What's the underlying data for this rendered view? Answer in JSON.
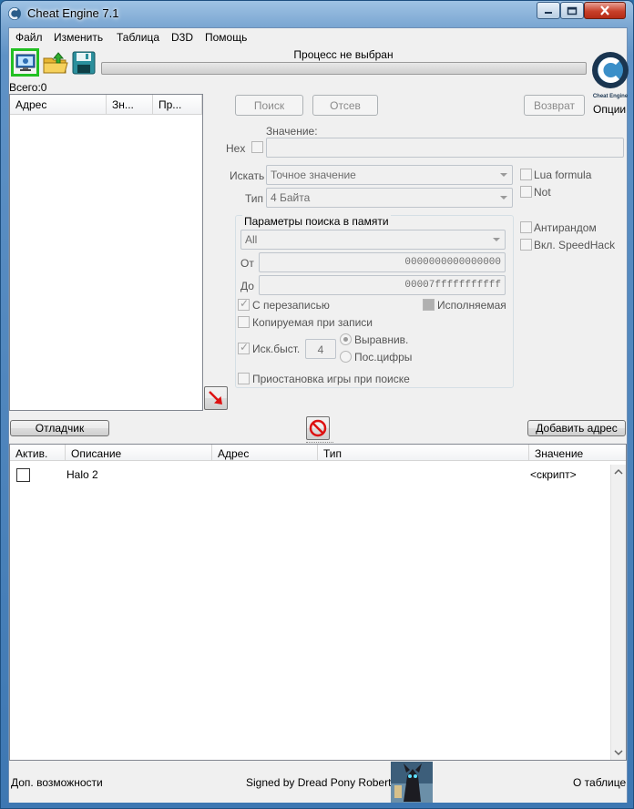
{
  "window": {
    "title": "Cheat Engine 7.1"
  },
  "menu": [
    "Файл",
    "Изменить",
    "Таблица",
    "D3D",
    "Помощь"
  ],
  "toolbar": {
    "process_label": "Процесс не выбран",
    "options_label": "Опции",
    "logo_text": "Cheat Engine"
  },
  "found": {
    "total_label": "Всего:0",
    "columns": [
      "Адрес",
      "Зн...",
      "Пр..."
    ]
  },
  "scan": {
    "first_scan": "Поиск",
    "next_scan": "Отсев",
    "undo_scan": "Возврат",
    "value_label": "Значение:",
    "hex_label": "Hex",
    "scan_type_label": "Искать",
    "scan_type_value": "Точное значение",
    "value_type_label": "Тип",
    "value_type_value": "4 Байта",
    "lua_formula": "Lua formula",
    "not_label": "Not",
    "anti_random": "Антирандом",
    "speedhack": "Вкл. SpeedHack"
  },
  "memory_options": {
    "title": "Параметры поиска в памяти",
    "region": "All",
    "from_label": "От",
    "from_value": "0000000000000000",
    "to_label": "До",
    "to_value": "00007fffffffffff",
    "writable": "С перезаписью",
    "executable": "Исполняемая",
    "copy_on_write": "Копируемая при записи",
    "fast_scan": "Иск.быст.",
    "fast_scan_value": "4",
    "alignment": "Выравнив.",
    "last_digits": "Пос.цифры",
    "pause_game": "Приостановка игры при поиске"
  },
  "bottom_buttons": {
    "memory_view": "Отладчик",
    "add_address": "Добавить адрес"
  },
  "address_table": {
    "columns": [
      "Актив.",
      "Описание",
      "Адрес",
      "Тип",
      "Значение"
    ],
    "rows": [
      {
        "active": false,
        "description": "Halo 2",
        "address": "",
        "type": "",
        "value": "<скрипт>"
      }
    ]
  },
  "status": {
    "advanced": "Доп. возможности",
    "signed": "Signed by Dread Pony Roberts",
    "about_table": "О таблице"
  }
}
